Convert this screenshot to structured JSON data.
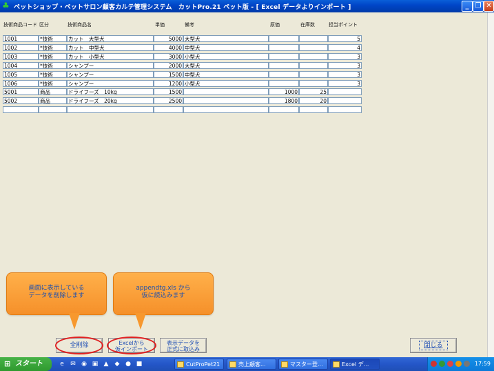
{
  "window": {
    "title": "ペットショップ・ペットサロン顧客カルテ管理システム　カットPro.21 ペット版 - [ Excel データよりインポート ]",
    "app_icon": "tree-icon",
    "minimize_icon": "minimize-icon",
    "restore_icon": "restore-icon",
    "close_icon": "close-icon"
  },
  "table": {
    "headers": {
      "code": "技術商品コード",
      "kubun": "区分",
      "name": "技術商品名",
      "price": "単価",
      "note": "備考",
      "cost": "原価",
      "stock": "在庫数",
      "points": "担当ポイント"
    },
    "rows": [
      {
        "code": "1001",
        "kubun": "*技術",
        "name": "カット　大型犬",
        "price": "5000",
        "note": "大型犬",
        "cost": "",
        "stock": "",
        "points": "5"
      },
      {
        "code": "1002",
        "kubun": "*技術",
        "name": "カット　中型犬",
        "price": "4000",
        "note": "中型犬",
        "cost": "",
        "stock": "",
        "points": "4"
      },
      {
        "code": "1003",
        "kubun": "*技術",
        "name": "カット　小型犬",
        "price": "3000",
        "note": "小型犬",
        "cost": "",
        "stock": "",
        "points": "3"
      },
      {
        "code": "1004",
        "kubun": "*技術",
        "name": "シャンプー",
        "price": "2000",
        "note": "大型犬",
        "cost": "",
        "stock": "",
        "points": "3"
      },
      {
        "code": "1005",
        "kubun": "*技術",
        "name": "シャンプー",
        "price": "1500",
        "note": "中型犬",
        "cost": "",
        "stock": "",
        "points": "3"
      },
      {
        "code": "1006",
        "kubun": "*技術",
        "name": "シャンプー",
        "price": "1200",
        "note": "小型犬",
        "cost": "",
        "stock": "",
        "points": "3"
      },
      {
        "code": "5001",
        "kubun": "商品",
        "name": "ドライフーズ　10kg",
        "price": "1500",
        "note": "",
        "cost": "1000",
        "stock": "25",
        "points": ""
      },
      {
        "code": "5002",
        "kubun": "商品",
        "name": "ドライフーズ　20kg",
        "price": "2500",
        "note": "",
        "cost": "1800",
        "stock": "20",
        "points": ""
      },
      {
        "code": "",
        "kubun": "",
        "name": "",
        "price": "",
        "note": "",
        "cost": "",
        "stock": "",
        "points": ""
      }
    ]
  },
  "callouts": {
    "left": "画面に表示している\nデータを削除します",
    "middle": "appendtg.xls から\n仮に読込みます"
  },
  "buttons": {
    "delete_all": "全削除",
    "import_line1": "Excelから",
    "import_line2": "仮インポート",
    "commit_line1": "表示データを",
    "commit_line2": "正式に取込み",
    "close": "閉じる"
  },
  "taskbar": {
    "start": "スタート",
    "tasks": [
      {
        "label": "CutProPet21",
        "active": false
      },
      {
        "label": "売上顧客...",
        "active": false
      },
      {
        "label": "マスター登...",
        "active": false
      },
      {
        "label": "Excel デ...",
        "active": true
      }
    ],
    "clock": "17:59"
  },
  "colors": {
    "titlebar": "#0046c8",
    "callout": "#f5902a",
    "callout_text": "#1a4fb0",
    "highlight": "#e02020",
    "button_text": "#1f4fb5"
  }
}
